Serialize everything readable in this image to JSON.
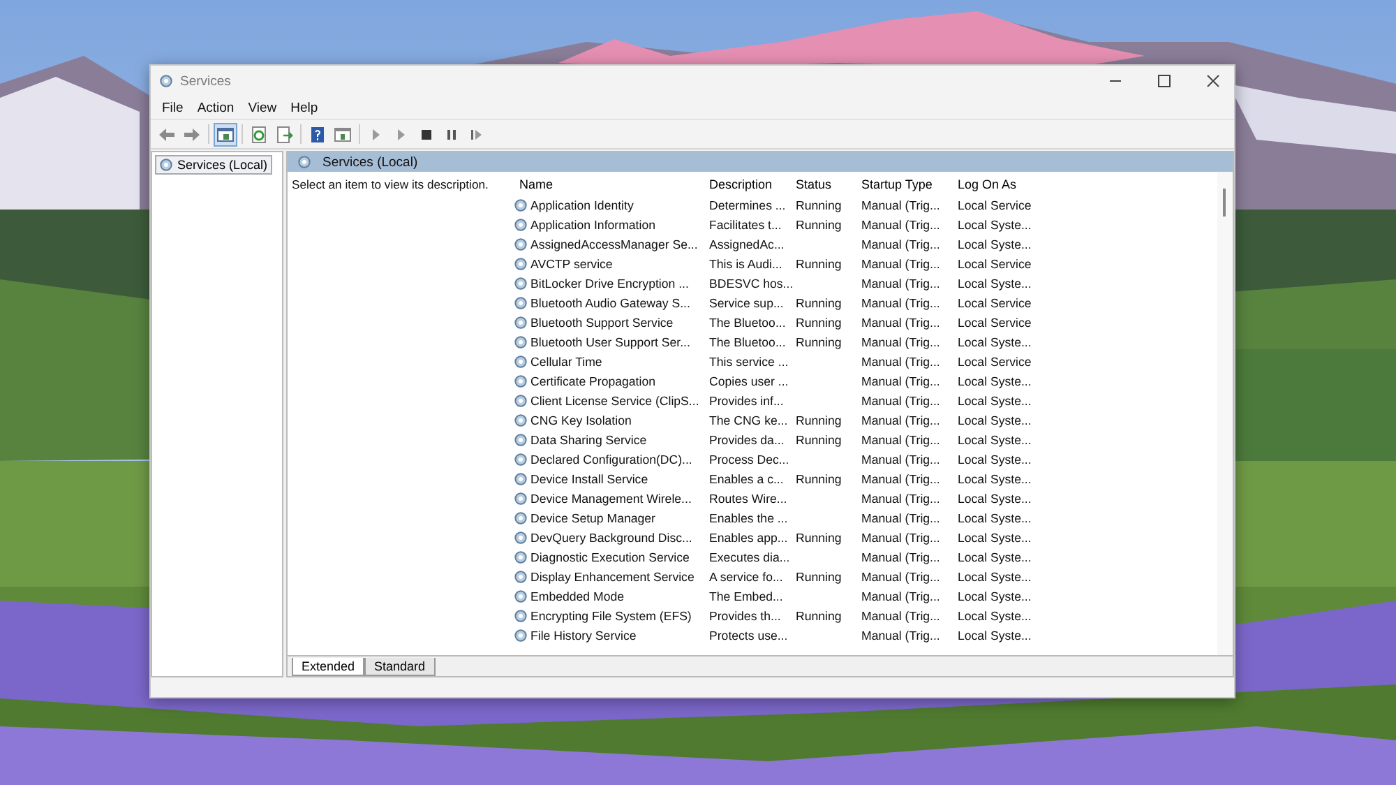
{
  "window": {
    "title": "Services"
  },
  "menu": [
    "File",
    "Action",
    "View",
    "Help"
  ],
  "tree": [
    {
      "label": "Services (Local)",
      "selected": true
    }
  ],
  "pane_header": "Services (Local)",
  "description_text": "Select an item to view its description.",
  "table": {
    "columns": [
      "Name",
      "Description",
      "Status",
      "Startup Type",
      "Log On As"
    ],
    "rows": [
      [
        "Application Identity",
        "Determines ...",
        "Running",
        "Manual (Trig...",
        "Local Service"
      ],
      [
        "Application Information",
        "Facilitates t...",
        "Running",
        "Manual (Trig...",
        "Local Syste..."
      ],
      [
        "AssignedAccessManager Se...",
        "AssignedAc...",
        "",
        "Manual (Trig...",
        "Local Syste..."
      ],
      [
        "AVCTP service",
        "This is Audi...",
        "Running",
        "Manual (Trig...",
        "Local Service"
      ],
      [
        "BitLocker Drive Encryption ...",
        "BDESVC hos...",
        "",
        "Manual (Trig...",
        "Local Syste..."
      ],
      [
        "Bluetooth Audio Gateway S...",
        "Service sup...",
        "Running",
        "Manual (Trig...",
        "Local Service"
      ],
      [
        "Bluetooth Support Service",
        "The Bluetoo...",
        "Running",
        "Manual (Trig...",
        "Local Service"
      ],
      [
        "Bluetooth User Support Ser...",
        "The Bluetoo...",
        "Running",
        "Manual (Trig...",
        "Local Syste..."
      ],
      [
        "Cellular Time",
        "This service ...",
        "",
        "Manual (Trig...",
        "Local Service"
      ],
      [
        "Certificate Propagation",
        "Copies user ...",
        "",
        "Manual (Trig...",
        "Local Syste..."
      ],
      [
        "Client License Service (ClipS...",
        "Provides inf...",
        "",
        "Manual (Trig...",
        "Local Syste..."
      ],
      [
        "CNG Key Isolation",
        "The CNG ke...",
        "Running",
        "Manual (Trig...",
        "Local Syste..."
      ],
      [
        "Data Sharing Service",
        "Provides da...",
        "Running",
        "Manual (Trig...",
        "Local Syste..."
      ],
      [
        "Declared Configuration(DC)...",
        "Process Dec...",
        "",
        "Manual (Trig...",
        "Local Syste..."
      ],
      [
        "Device Install Service",
        "Enables a c...",
        "Running",
        "Manual (Trig...",
        "Local Syste..."
      ],
      [
        "Device Management Wirele...",
        "Routes Wire...",
        "",
        "Manual (Trig...",
        "Local Syste..."
      ],
      [
        "Device Setup Manager",
        "Enables the ...",
        "",
        "Manual (Trig...",
        "Local Syste..."
      ],
      [
        "DevQuery Background Disc...",
        "Enables app...",
        "Running",
        "Manual (Trig...",
        "Local Syste..."
      ],
      [
        "Diagnostic Execution Service",
        "Executes dia...",
        "",
        "Manual (Trig...",
        "Local Syste..."
      ],
      [
        "Display Enhancement Service",
        "A service fo...",
        "Running",
        "Manual (Trig...",
        "Local Syste..."
      ],
      [
        "Embedded Mode",
        "The Embed...",
        "",
        "Manual (Trig...",
        "Local Syste..."
      ],
      [
        "Encrypting File System (EFS)",
        "Provides th...",
        "Running",
        "Manual (Trig...",
        "Local Syste..."
      ],
      [
        "File History Service",
        "Protects use...",
        "",
        "Manual (Trig...",
        "Local Syste..."
      ]
    ]
  },
  "tabs": [
    {
      "label": "Extended",
      "selected": true
    },
    {
      "label": "Standard",
      "selected": false
    }
  ]
}
